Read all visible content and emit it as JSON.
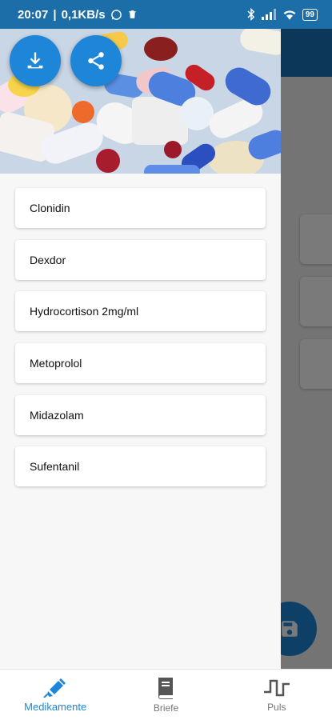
{
  "status_bar": {
    "time": "20:07",
    "network_speed": "0,1KB/s",
    "battery": "99"
  },
  "drawer": {
    "header_buttons": {
      "download_icon": "download-icon",
      "share_icon": "share-icon"
    },
    "items": [
      {
        "label": "Clonidin"
      },
      {
        "label": "Dexdor"
      },
      {
        "label": "Hydrocortison 2mg/ml"
      },
      {
        "label": "Metoprolol"
      },
      {
        "label": "Midazolam"
      },
      {
        "label": "Sufentanil"
      }
    ]
  },
  "bottom_nav": {
    "items": [
      {
        "label": "Medikamente",
        "icon": "syringe-icon",
        "active": true
      },
      {
        "label": "Briefe",
        "icon": "book-icon",
        "active": false
      },
      {
        "label": "Puls",
        "icon": "pulse-icon",
        "active": false
      }
    ]
  },
  "colors": {
    "accent": "#1e86d8",
    "appbar": "#1a74b8",
    "statusbar": "#1b6ea8"
  }
}
